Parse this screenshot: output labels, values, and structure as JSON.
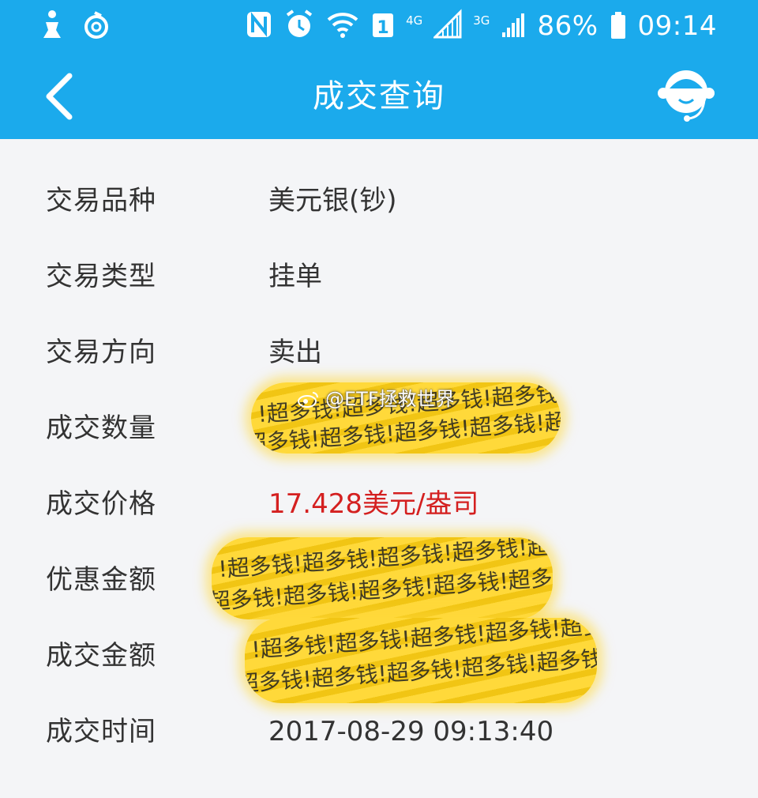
{
  "status_bar": {
    "network_4g": "4G",
    "network_3g": "3G",
    "sim_badge": "1",
    "battery": "86%",
    "time": "09:14",
    "icons": [
      "person-icon",
      "netease-music-icon",
      "nfc-icon",
      "alarm-icon",
      "wifi-icon",
      "sim-icon",
      "signal-icon",
      "signal-icon",
      "battery-icon"
    ]
  },
  "app_bar": {
    "title": "成交查询",
    "back_icon": "chevron-left-icon",
    "service_icon": "customer-service-icon"
  },
  "details": [
    {
      "label": "交易品种",
      "value": "美元银(钞)"
    },
    {
      "label": "交易类型",
      "value": "挂单"
    },
    {
      "label": "交易方向",
      "value": "卖出"
    },
    {
      "label": "成交数量",
      "value": "",
      "redacted": true
    },
    {
      "label": "成交价格",
      "value": "17.428美元/盎司",
      "color": "#d42020"
    },
    {
      "label": "优惠金额",
      "value": "",
      "redacted": true
    },
    {
      "label": "成交金额",
      "value": "",
      "redacted": true
    },
    {
      "label": "成交时间",
      "value": "2017-08-29 09:13:40"
    }
  ],
  "redaction_text": "!超多钱!超多钱!超多钱!超多钱!超多钱!超多钱!超多钱!超多钱!超",
  "watermark": "@ETF拯救世界",
  "colors": {
    "primary": "#1baaec",
    "highlight": "#ffd93a",
    "price": "#d42020"
  }
}
